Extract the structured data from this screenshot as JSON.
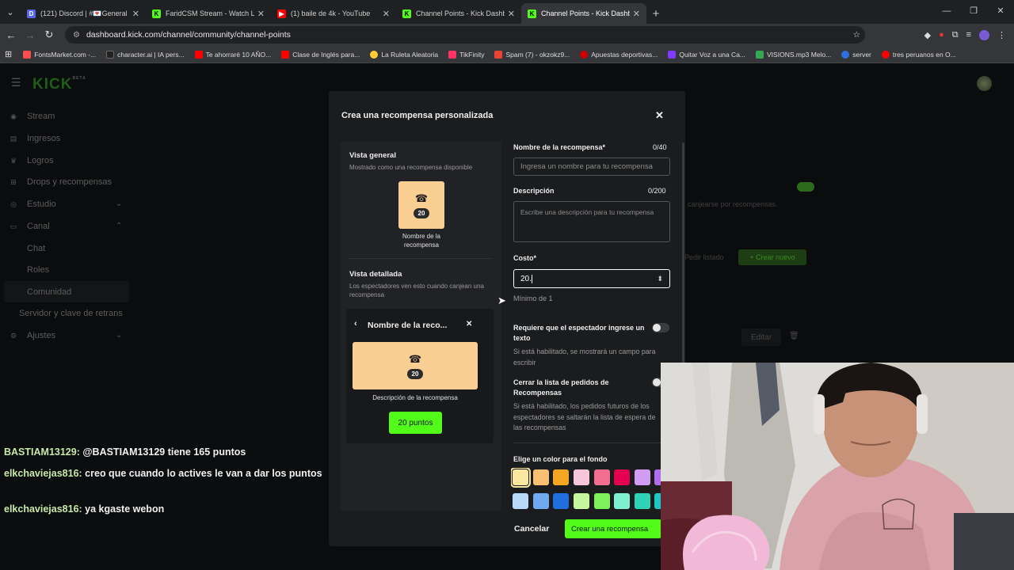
{
  "browser": {
    "tabs": [
      {
        "title": "(121) Discord | #💌General |",
        "fav_color": "#5865f2",
        "fav_text": "D",
        "active": false
      },
      {
        "title": "FaridCSM Stream - Watch Live",
        "fav_color": "#53fc18",
        "fav_text": "K",
        "active": false
      },
      {
        "title": "(1) baile de 4k - YouTube",
        "fav_color": "#ff0000",
        "fav_text": "▶",
        "active": false
      },
      {
        "title": "Channel Points - Kick Dashboar",
        "fav_color": "#53fc18",
        "fav_text": "K",
        "active": false
      },
      {
        "title": "Channel Points - Kick Dashboar",
        "fav_color": "#53fc18",
        "fav_text": "K",
        "active": true
      }
    ],
    "url": "dashboard.kick.com/channel/community/channel-points",
    "bookmarks": [
      {
        "label": "FontsMarket.com -...",
        "color": "#ff4d4d"
      },
      {
        "label": "character.ai | IA pers...",
        "color": "#222222"
      },
      {
        "label": "Te ahorraré 10 AÑO...",
        "color": "#ff0000"
      },
      {
        "label": "Clase de Inglés para...",
        "color": "#ff0000"
      },
      {
        "label": "La Ruleta Aleatoria",
        "color": "#ffcc33"
      },
      {
        "label": "TikFinity",
        "color": "#ff3366"
      },
      {
        "label": "Spam (7) - okzokz9...",
        "color": "#ea4335"
      },
      {
        "label": "Apuestas deportivas...",
        "color": "#cc0000"
      },
      {
        "label": "Quitar Voz a una Ca...",
        "color": "#7d3cff"
      },
      {
        "label": "VISIONS.mp3 Melo...",
        "color": "#34a853"
      },
      {
        "label": "server",
        "color": "#2f6fde"
      },
      {
        "label": "tres peruanos en O...",
        "color": "#ff0000"
      }
    ]
  },
  "sidebar": {
    "items": [
      {
        "label": "Stream",
        "icon": "broadcast-icon"
      },
      {
        "label": "Ingresos",
        "icon": "money-icon"
      },
      {
        "label": "Logros",
        "icon": "trophy-icon"
      },
      {
        "label": "Drops y recompensas",
        "icon": "gift-icon"
      },
      {
        "label": "Estudio",
        "icon": "studio-icon"
      },
      {
        "label": "Canal",
        "icon": "channel-icon"
      },
      {
        "label": "Chat",
        "icon": ""
      },
      {
        "label": "Roles",
        "icon": ""
      },
      {
        "label": "Comunidad",
        "icon": ""
      },
      {
        "label": "Servidor y clave de retrans",
        "icon": ""
      },
      {
        "label": "Ajustes",
        "icon": "gear-icon"
      }
    ]
  },
  "background": {
    "hint": "canjearse por recompensas.",
    "edit_list": "Pedir listado",
    "create_new": "+ Crear nuevo",
    "edit": "Editar"
  },
  "modal": {
    "title": "Crea una recompensa personalizada",
    "overview_title": "Vista general",
    "overview_sub": "Mostrado como una recompensa disponible",
    "preview_cost": "20",
    "preview_name": "Nombre de la recompensa",
    "detail_title": "Vista detallada",
    "detail_sub": "Los espectadores ven esto cuando canjean una recompensa",
    "detail_header": "Nombre de la reco...",
    "detail_cost": "20",
    "detail_desc": "Descripción de la recompensa",
    "detail_button": "20 puntos",
    "name_label": "Nombre de la recompensa*",
    "name_count": "0/40",
    "name_placeholder": "Ingresa un nombre para tu recompensa",
    "desc_label": "Descripción",
    "desc_count": "0/200",
    "desc_placeholder": "Escribe una descripción para tu recompensa",
    "cost_label": "Costo*",
    "cost_value": "20.",
    "cost_hint": "Mínimo de 1",
    "req_text_label": "Requiere que el espectador ingrese un texto",
    "req_text_sub": "Si está habilitado, se mostrará un campo para escribir",
    "close_list_label": "Cerrar la lista de pedidos de Recompensas",
    "close_list_sub": "Si está habilitado, los pedidos futuros de los espectadores se saltarán la lista de espera de las recompensas",
    "color_label": "Elige un color para el fondo",
    "colors_row1": [
      "#f9e79f",
      "#f9c074",
      "#f5a623",
      "#f7c6d9",
      "#f26d8f",
      "#e5004f",
      "#d29cf5",
      "#b26cf0"
    ],
    "colors_row2": [
      "#b8d8f8",
      "#6faaf0",
      "#1f6fde",
      "#c5f59c",
      "#7ef05a",
      "#7ff0cf",
      "#2ed3b7",
      "#20c5c5"
    ],
    "cancel": "Cancelar",
    "create": "Crear una recompensa"
  },
  "chat": [
    {
      "user": "BASTIAM13129:",
      "msg": " @BASTIAM13129 tiene 165 puntos"
    },
    {
      "user": "elkchaviejas816:",
      "msg": " creo que cuando lo actives le van a dar los puntos"
    },
    {
      "user": "elkchaviejas816:",
      "msg": " ya kgaste webon"
    }
  ]
}
